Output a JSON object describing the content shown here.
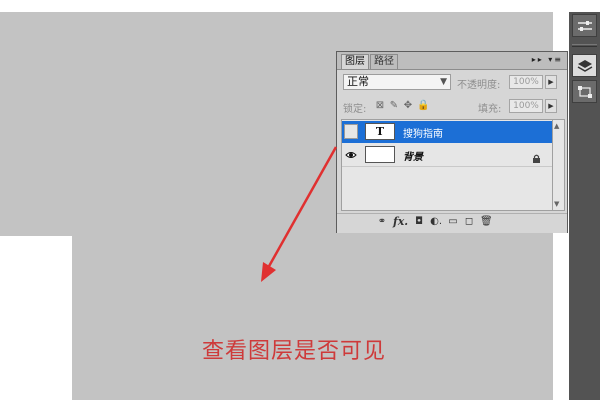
{
  "layers_panel": {
    "tabs": [
      {
        "label": "图层",
        "active": true
      },
      {
        "label": "路径",
        "active": false
      }
    ],
    "titlebar_icons": "▸▸ ▾≡",
    "blend_mode": "正常",
    "opacity_label": "不透明度:",
    "opacity_value": "100%",
    "lock_label": "锁定:",
    "fill_label": "填充:",
    "fill_value": "100%",
    "layers": [
      {
        "thumb_text": "T",
        "name": "搜狗指南",
        "selected": true,
        "visible": false
      },
      {
        "thumb_text": "",
        "name": "背景",
        "selected": false,
        "visible": true,
        "locked": true
      }
    ],
    "bottom_icons": {
      "link": "⚭",
      "fx": "fx.",
      "mask": "◘",
      "adjustment": "◐.",
      "group": "▭",
      "new_layer": "◻",
      "delete": "🗑"
    }
  },
  "annotation": {
    "text": "查看图层是否可见",
    "color": "#ce3a3a"
  },
  "colors": {
    "selected_row": "#1c6fd6",
    "workspace_bg": "#c3c3c3",
    "dock_bg": "#535353"
  }
}
